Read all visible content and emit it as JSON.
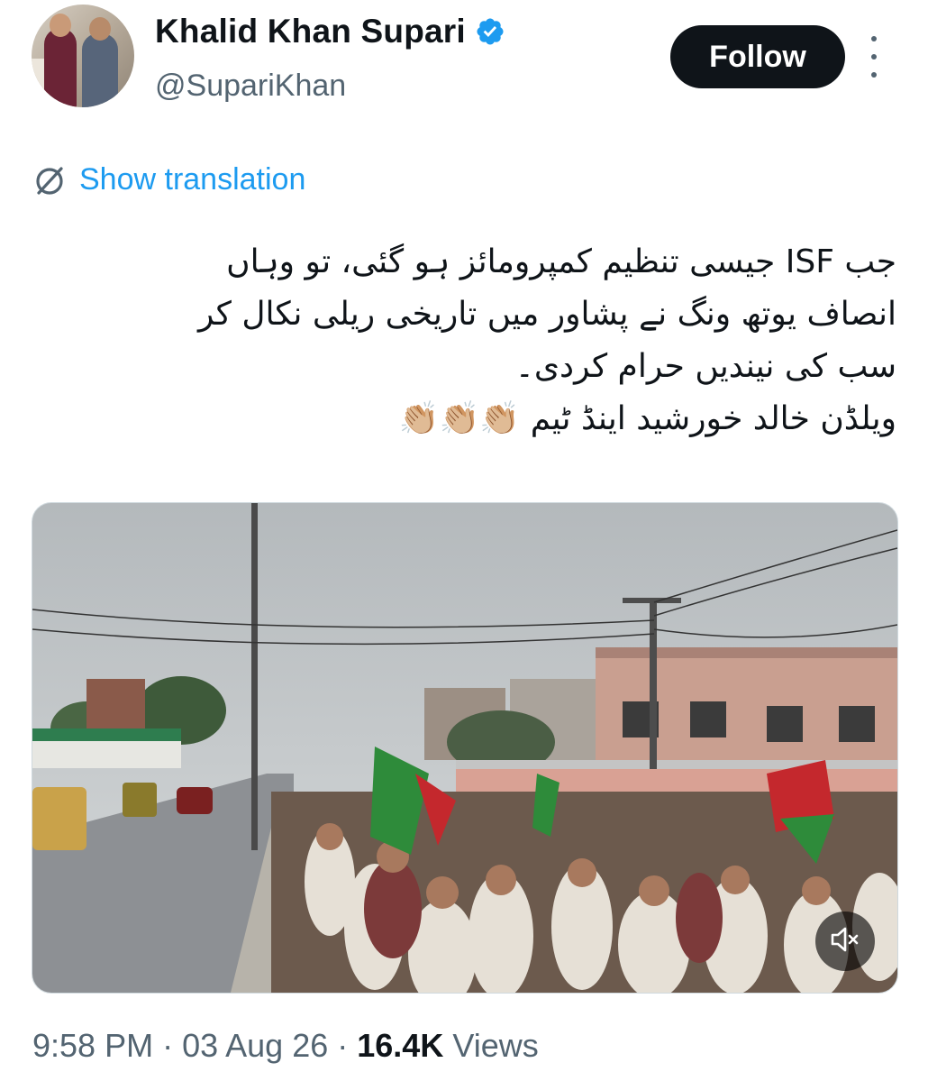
{
  "author": {
    "display_name": "Khalid Khan Supari",
    "handle": "@SupariKhan",
    "verified_icon": "verified-badge-icon",
    "verified_color": "#1d9bf0"
  },
  "actions": {
    "follow_label": "Follow",
    "more_icon": "more-vertical-icon"
  },
  "translation": {
    "label": "Show translation",
    "icon": "translate-icon",
    "color": "#1d9bf0"
  },
  "tweet": {
    "lines": [
      "جب ISF جیسی تنظیم کمپرومائز ہو گئی، تو وہاں",
      "انصاف یوتھ ونگ نے پشاور میں تاریخی ریلی نکال کر",
      "سب کی نیندیں حرام کردی۔",
      "ویلڈن خالد خورشید اینڈ ٹیم 👏🏼👏🏼👏🏼"
    ]
  },
  "media": {
    "type": "video",
    "mute_icon": "volume-muted-icon"
  },
  "meta": {
    "time": "9:58 PM",
    "separator": "·",
    "date": "03 Aug 26",
    "views_count": "16.4K",
    "views_label": "Views"
  }
}
